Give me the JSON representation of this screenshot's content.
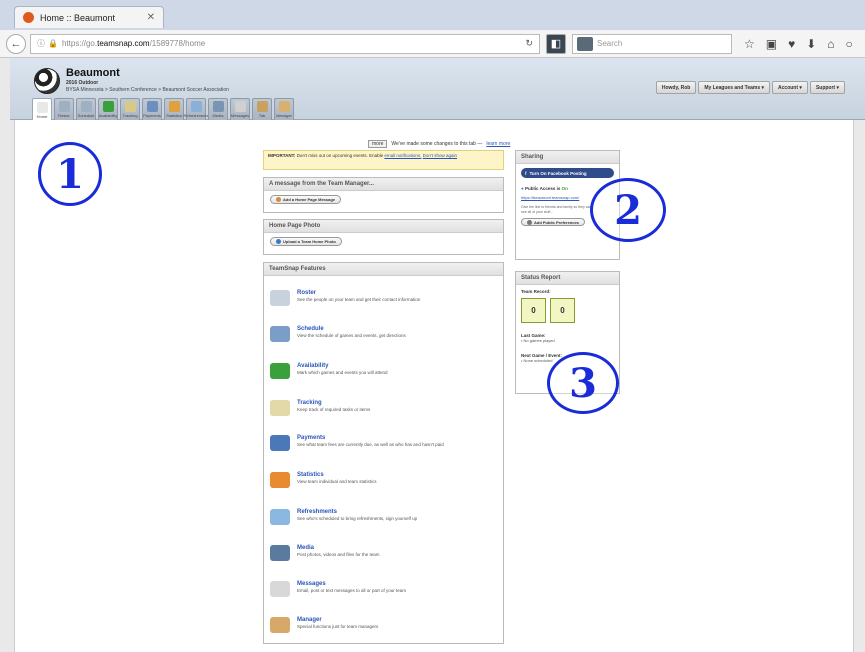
{
  "browser": {
    "tab_title": "Home :: Beaumont",
    "url_prefix": "https://go.",
    "url_domain": "teamsnap.com",
    "url_suffix": "/1589778/home",
    "search_placeholder": "Search"
  },
  "header": {
    "team_name": "Beaumont",
    "season": "2016 Outdoor",
    "league": "BYSA Minnesota > Southern Conference > Beaumont Soccer Association",
    "menus": [
      "Howdy, Rob",
      "My Leagues and Teams ▾",
      "Account ▾",
      "Support ▾"
    ]
  },
  "nav_tabs": [
    {
      "label": "Home",
      "color": "#e8e8e8"
    },
    {
      "label": "Roster",
      "color": "#9fb0c2"
    },
    {
      "label": "Schedule",
      "color": "#9fb0c2"
    },
    {
      "label": "Availability",
      "color": "#3aa03a"
    },
    {
      "label": "Tracking",
      "color": "#d8c98a"
    },
    {
      "label": "Payments",
      "color": "#6d8fbf"
    },
    {
      "label": "Statistics",
      "color": "#e0a040"
    },
    {
      "label": "Refreshments",
      "color": "#8ab0d8"
    },
    {
      "label": "Media",
      "color": "#7a94b4"
    },
    {
      "label": "Messages",
      "color": "#d0d0d0"
    },
    {
      "label": "Tab",
      "color": "#c8a060"
    },
    {
      "label": "Manager",
      "color": "#d8b070"
    }
  ],
  "notice": {
    "button": "more",
    "text": "We've made some changes to this tab —",
    "link": "learn more"
  },
  "important": {
    "label": "IMPORTANT:",
    "text": "Don't miss out on upcoming events. Enable",
    "link1": "email notifications.",
    "link2": "Don't show again"
  },
  "message_panel": {
    "title": "A message from the Team Manager...",
    "button": "Add a Home Page Message"
  },
  "photo_panel": {
    "title": "Home Page Photo",
    "button": "Upload a Team Home Photo"
  },
  "features_panel": {
    "title": "TeamSnap Features",
    "items": [
      {
        "title": "Roster",
        "desc": "See the people on your team and get their contact information",
        "color": "#c8d2dc"
      },
      {
        "title": "Schedule",
        "desc": "View the schedule of games and events, get directions",
        "color": "#7a9ec8"
      },
      {
        "title": "Availability",
        "desc": "Mark which games and events you will attend",
        "color": "#3aa03a"
      },
      {
        "title": "Tracking",
        "desc": "Keep track of required tasks or items",
        "color": "#e2d8a8"
      },
      {
        "title": "Payments",
        "desc": "See what team fees are currently due, as well as who has and hasn't paid",
        "color": "#4a78b8"
      },
      {
        "title": "Statistics",
        "desc": "View team individual and team statistics",
        "color": "#e88a30"
      },
      {
        "title": "Refreshments",
        "desc": "See who's scheduled to bring refreshments, sign yourself up",
        "color": "#8ab8e0"
      },
      {
        "title": "Media",
        "desc": "Post photos, videos and files for the team",
        "color": "#5a7aa0"
      },
      {
        "title": "Messages",
        "desc": "Email, post or text messages to all or part of your team",
        "color": "#d8d8d8"
      },
      {
        "title": "Manager",
        "desc": "Special functions just for team managers",
        "color": "#d8a868"
      }
    ]
  },
  "sharing": {
    "title": "Sharing",
    "fb_button": "Turn On Facebook Posting",
    "public_label": "Public Access is",
    "public_status": "On",
    "public_url": "https://beaumont.teamsnap.com/",
    "desc": "Give the link to friends and family so they can see all of your stuff...",
    "button": "Add Public Preferences"
  },
  "status": {
    "title": "Status Report",
    "record_label": "Team Record:",
    "wins": "0",
    "losses": "0",
    "last_label": "Last Game:",
    "last_value": "• No games played",
    "next_label": "Next Game / Event:",
    "next_value": "• None scheduled"
  },
  "markers": [
    "①",
    "②",
    "③"
  ]
}
